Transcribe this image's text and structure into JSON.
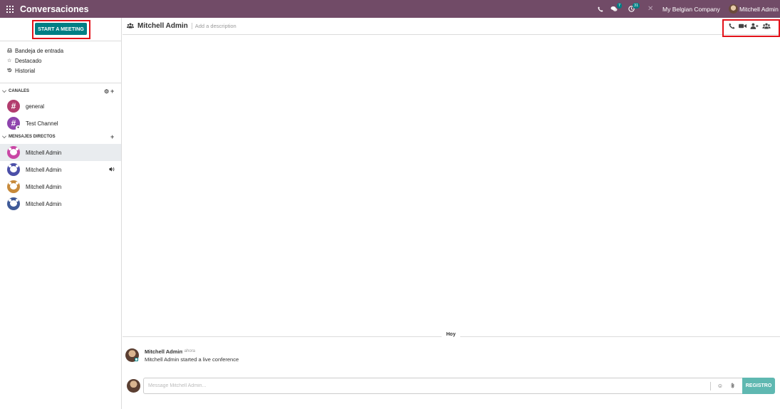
{
  "colors": {
    "brand": "#714b67",
    "accent": "#017e84",
    "send_disabled": "#5fb8b1",
    "highlight": "#e3121a",
    "active_row": "#e9ecef"
  },
  "topbar": {
    "app_title": "Conversaciones",
    "apps_icon": "grid-icon",
    "phone_icon": "phone-icon",
    "messages_icon": "chat-icon",
    "messages_count": "7",
    "activity_icon": "clock-icon",
    "activity_count": "31",
    "debug_icon": "tools-icon",
    "company": "My Belgian Company",
    "user": "Mitchell Admin"
  },
  "sidebar": {
    "start_meeting_label": "START A MEETING",
    "mailboxes": [
      {
        "label": "Bandeja de entrada",
        "icon": "inbox-icon"
      },
      {
        "label": "Destacado",
        "icon": "star-icon"
      },
      {
        "label": "Historial",
        "icon": "history-icon"
      }
    ],
    "channels_label": "CANALES",
    "channels": [
      {
        "label": "general",
        "icon": "hash-icon",
        "color": "#b23c6e"
      },
      {
        "label": "Test Channel",
        "icon": "hash-lock-icon",
        "color": "#8e44ad"
      }
    ],
    "direct_label": "MENSAJES DIRECTOS",
    "direct": [
      {
        "label": "Mitchell Admin",
        "color": "#c946a5",
        "active": true
      },
      {
        "label": "Mitchell Admin",
        "color": "#4b4fa8",
        "in_call": true
      },
      {
        "label": "Mitchell Admin",
        "color": "#c78a3b"
      },
      {
        "label": "Mitchell Admin",
        "color": "#3f5a98"
      }
    ]
  },
  "thread": {
    "name": "Mitchell Admin",
    "description_placeholder": "Add a description",
    "header_icons": [
      "phone-icon",
      "video-camera-icon",
      "add-user-icon",
      "members-icon"
    ],
    "date_separator": "Hoy",
    "messages": [
      {
        "author": "Mitchell Admin",
        "time": "- ahora",
        "body": "Mitchell Admin started a live conference"
      }
    ],
    "composer": {
      "placeholder": "Message Mitchell Admin...",
      "emoji_icon": "smile-icon",
      "attach_icon": "paperclip-icon",
      "send_label": "REGISTRO"
    }
  }
}
